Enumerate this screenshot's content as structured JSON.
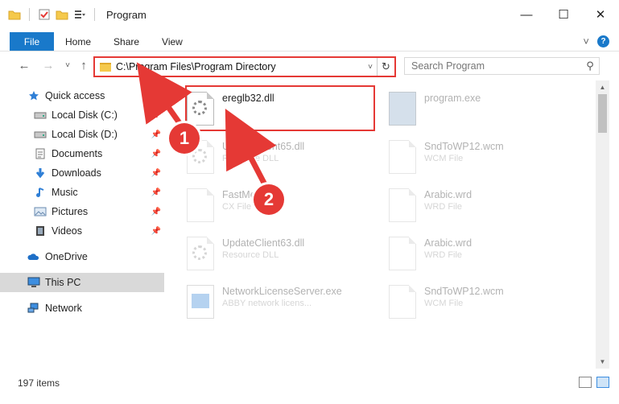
{
  "window": {
    "title": "Program",
    "controls": {
      "minimize": "—",
      "maximize": "☐",
      "close": "✕"
    }
  },
  "ribbon": {
    "tabs": [
      {
        "label": "File"
      },
      {
        "label": "Home"
      },
      {
        "label": "Share"
      },
      {
        "label": "View"
      }
    ],
    "collapse_icon": "˅",
    "help_icon": "?"
  },
  "address_bar": {
    "path": "C:\\Program Files\\Program Directory",
    "dropdown_icon": "˅",
    "refresh_icon": "↻"
  },
  "search": {
    "placeholder": "Search Program",
    "icon": "⚲"
  },
  "nav_buttons": {
    "back": "←",
    "forward": "→",
    "recent": "˅",
    "up": "↑"
  },
  "nav_pane": {
    "items": [
      {
        "label": "Quick access",
        "icon": "star-icon",
        "pinned": false
      },
      {
        "label": "Local Disk (C:)",
        "icon": "drive-icon",
        "pinned": true
      },
      {
        "label": "Local Disk (D:)",
        "icon": "drive-icon",
        "pinned": true
      },
      {
        "label": "Documents",
        "icon": "documents-icon",
        "pinned": true
      },
      {
        "label": "Downloads",
        "icon": "download-icon",
        "pinned": true
      },
      {
        "label": "Music",
        "icon": "music-icon",
        "pinned": true
      },
      {
        "label": "Pictures",
        "icon": "pictures-icon",
        "pinned": true
      },
      {
        "label": "Videos",
        "icon": "videos-icon",
        "pinned": true
      },
      {
        "label": "OneDrive",
        "icon": "cloud-icon",
        "pinned": false
      },
      {
        "label": "This PC",
        "icon": "computer-icon",
        "pinned": false,
        "selected": true
      },
      {
        "label": "Network",
        "icon": "network-icon",
        "pinned": false
      }
    ],
    "pin_glyph": "📌"
  },
  "files": [
    {
      "name": "ereglb32.dll",
      "type": "",
      "highlighted": true
    },
    {
      "name": "program.exe",
      "type": ""
    },
    {
      "name": "UpdateClient65.dll",
      "type": "Resource DLL"
    },
    {
      "name": "SndToWP12.wcm",
      "type": "WCM File"
    },
    {
      "name": "FastMe",
      "type": "CX File"
    },
    {
      "name": "Arabic.wrd",
      "type": "WRD File"
    },
    {
      "name": "UpdateClient63.dll",
      "type": "Resource DLL"
    },
    {
      "name": "Arabic.wrd",
      "type": "WRD File"
    },
    {
      "name": "NetworkLicenseServer.exe",
      "type": "ABBY network licens..."
    },
    {
      "name": "SndToWP12.wcm",
      "type": "WCM File"
    }
  ],
  "annotations": {
    "step1": "1",
    "step2": "2",
    "accent": "#e53935"
  },
  "status": {
    "item_count": "197 items"
  }
}
